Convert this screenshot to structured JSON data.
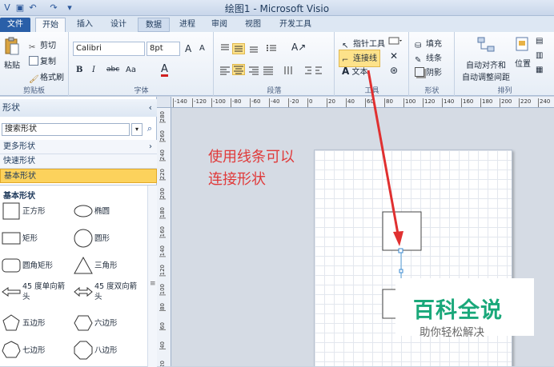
{
  "window": {
    "title": "绘图1 - Microsoft Visio"
  },
  "tabs": [
    {
      "label": "文件"
    },
    {
      "label": "开始"
    },
    {
      "label": "插入"
    },
    {
      "label": "设计"
    },
    {
      "label": "数据"
    },
    {
      "label": "进程"
    },
    {
      "label": "审阅"
    },
    {
      "label": "视图"
    },
    {
      "label": "开发工具"
    }
  ],
  "ribbon": {
    "clipboard": {
      "paste": "粘贴",
      "cut": "剪切",
      "copy": "复制",
      "format_painter": "格式刷",
      "label": "剪贴板"
    },
    "font": {
      "family": "Calibri",
      "size": "8pt",
      "bold": "B",
      "italic": "I",
      "strike": "abc",
      "aa": "Aa",
      "fontcolor": "A",
      "grow": "A",
      "shrink": "A",
      "label": "字体"
    },
    "paragraph": {
      "label": "段落"
    },
    "tools": {
      "pointer": "指针工具",
      "connector": "连接线",
      "text": "文本",
      "label": "工具"
    },
    "shape": {
      "fill": "填充",
      "line": "线条",
      "shadow": "阴影",
      "label": "形状"
    },
    "arrange": {
      "auto_align": "自动对齐和",
      "auto_space": "自动调整间距",
      "position": "位置",
      "label": "排列"
    }
  },
  "shapes_panel": {
    "title": "形状",
    "search_placeholder": "搜索形状",
    "more_shapes": "更多形状",
    "quick_shapes": "快速形状",
    "basic_shapes": "基本形状",
    "section_title": "基本形状",
    "items": [
      {
        "label": "正方形",
        "icon": "square-icon"
      },
      {
        "label": "椭圆",
        "icon": "ellipse-icon"
      },
      {
        "label": "矩形",
        "icon": "rectangle-icon"
      },
      {
        "label": "圆形",
        "icon": "circle-icon"
      },
      {
        "label": "圆角矩形",
        "icon": "rounded-rectangle-icon"
      },
      {
        "label": "三角形",
        "icon": "triangle-icon"
      },
      {
        "label": "45 度单向箭头",
        "icon": "single-arrow-icon"
      },
      {
        "label": "45 度双向箭头",
        "icon": "double-arrow-icon"
      },
      {
        "label": "五边形",
        "icon": "pentagon-icon"
      },
      {
        "label": "六边形",
        "icon": "hexagon-icon"
      },
      {
        "label": "七边形",
        "icon": "heptagon-icon"
      },
      {
        "label": "八边形",
        "icon": "octagon-icon"
      }
    ]
  },
  "ruler": {
    "h_ticks": [
      "-140",
      "-120",
      "-100",
      "-80",
      "-60",
      "-40",
      "-20",
      "0",
      "20",
      "40",
      "60",
      "80",
      "100",
      "120",
      "140",
      "160",
      "180",
      "200",
      "220",
      "240"
    ],
    "v_ticks": [
      "280",
      "260",
      "240",
      "220",
      "200",
      "180",
      "160",
      "140",
      "120",
      "100",
      "80",
      "60",
      "40",
      "20",
      "0"
    ]
  },
  "annotation": {
    "line1": "使用线条可以",
    "line2": "连接形状"
  },
  "watermark": {
    "title": "百科全说",
    "subtitle": "助你轻松解决"
  },
  "colors": {
    "accent": "#2a5fa8",
    "highlight": "#fde28a",
    "annotation": "#e03a3a",
    "watermark_green": "#1aa87a"
  }
}
